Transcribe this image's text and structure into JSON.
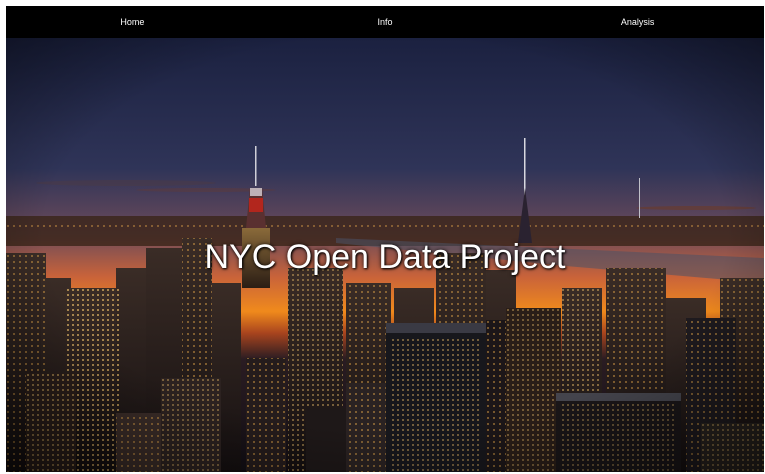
{
  "nav": {
    "items": [
      {
        "label": "Home"
      },
      {
        "label": "Info"
      },
      {
        "label": "Analysis"
      }
    ]
  },
  "hero": {
    "title": "NYC Open Data Project"
  },
  "colors": {
    "navbar": "#000000",
    "sky_top": "#1c2344",
    "horizon": "#f07a1a",
    "text": "#ffffff"
  }
}
